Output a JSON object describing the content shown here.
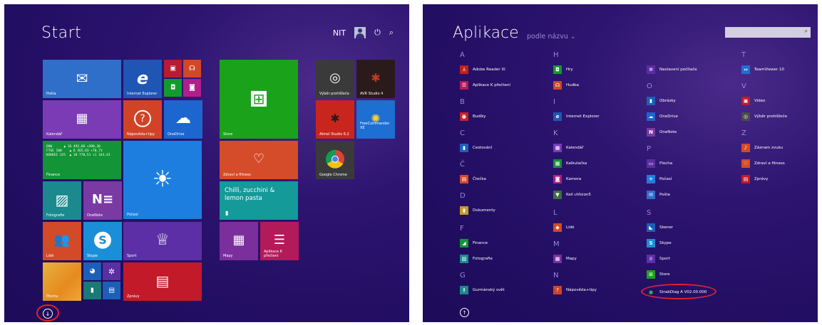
{
  "start": {
    "title": "Start",
    "user_name": "NIT",
    "power_icon": "⏻",
    "search_icon": "⌕",
    "tiles": {
      "posta": "Pošta",
      "ie": "Internet Explorer",
      "kalendar": "Kalendář",
      "napoveda": "Nápověda+tipy",
      "onedrive": "OneDrive",
      "store": "Store",
      "vyber": "Výběr prohlížeče",
      "avr": "AVR Studio 4",
      "atmel": "Atmel Studio 6.2",
      "freecommander": "FreeCommander XE",
      "finance": "Finance",
      "finance_quotes": "DOW      ▲ 16 492,60 +390,30\nFTSE 100    ▲ 6 265,83 +78,73\nNIKKEI 225  ▲ 18 770,51 +1 343,43",
      "pocasi": "Počasí",
      "zdravi": "Zdraví a fitness",
      "chrome": "Google Chrome",
      "recipe": "Chilli, zucchini & lemon pasta",
      "fotografie": "Fotografie",
      "onenote": "OneNote",
      "lide": "Lidé",
      "skype": "Skype",
      "sport": "Sport",
      "mapy": "Mapy",
      "aplikace_k_prectenii": "Aplikace K přečtení",
      "plocha": "Plocha",
      "zpravy": "Zprávy"
    }
  },
  "apps": {
    "title": "Aplikace",
    "sort_label": "podle názvu ⌄",
    "search_icon": "⌕",
    "letters": {
      "A": "A",
      "B": "B",
      "C": "C",
      "C2": "Č",
      "D": "D",
      "F": "F",
      "G": "G",
      "H": "H",
      "I": "I",
      "K": "K",
      "L": "L",
      "M": "M",
      "N": "N",
      "O": "O",
      "P": "P",
      "S": "S",
      "T": "T",
      "V": "V",
      "Z": "Z"
    },
    "items": {
      "adobe": "Adobe Reader XI",
      "aplikace_k": "Aplikace K přečtení",
      "budiky": "Budíky",
      "cestovani": "Cestování",
      "ctecka": "Čtečka",
      "dokumenty": "Dokumenty",
      "finance": "Finance",
      "fotografie": "Fotografie",
      "gurmansky": "Gurmánský svět",
      "hry": "Hry",
      "hudba": "Hudba",
      "ie": "Internet Explorer",
      "kalendar": "Kalendář",
      "kalkulacka": "Kalkulačka",
      "kamera": "Kamera",
      "keil": "Keil uVision5",
      "lide": "Lidé",
      "mapy": "Mapy",
      "napoveda": "Nápověda+tipy",
      "nastaveni": "Nastavení počítače",
      "obrazky": "Obrázky",
      "onedrive": "OneDrive",
      "onenote": "OneNote",
      "plocha": "Plocha",
      "pocasi": "Počasí",
      "posta": "Pošta",
      "skener": "Skener",
      "skype": "Skype",
      "sport": "Sport",
      "store": "Store",
      "strabdiag": "StrabDiag A V02.00.000",
      "teamviewer": "TeamViewer 10",
      "video": "Video",
      "vyber": "Výběr prohlížeče",
      "zaznam": "Záznam zvuku",
      "zdravi": "Zdraví a fitness",
      "zpravy": "Zprávy"
    }
  },
  "colors": {
    "background": "#220e63",
    "highlight_ellipse": "#e4202d",
    "letter_header": "#9b8ad4"
  }
}
